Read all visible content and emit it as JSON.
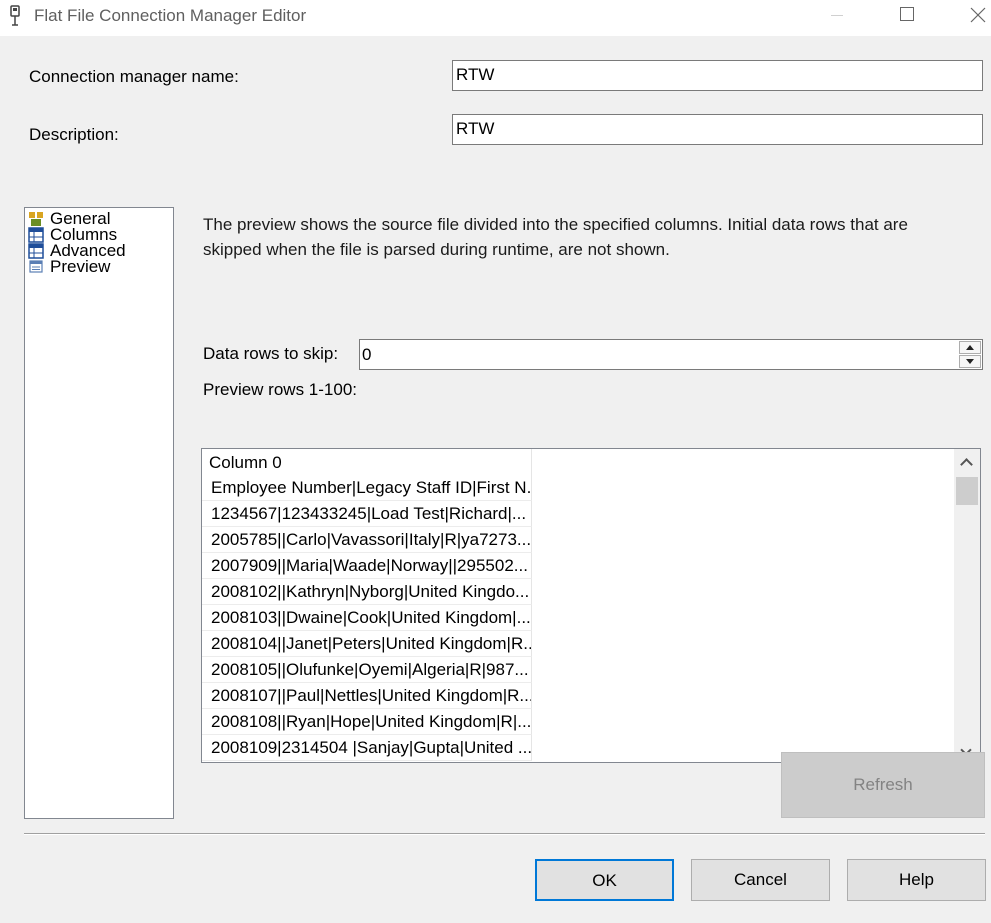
{
  "window": {
    "title": "Flat File Connection Manager Editor"
  },
  "form": {
    "name_label": "Connection manager name:",
    "name_value": "RTW",
    "description_label": "Description:",
    "description_value": "RTW"
  },
  "nav": {
    "items": [
      {
        "label": "General",
        "icon": "general-icon"
      },
      {
        "label": "Columns",
        "icon": "columns-icon"
      },
      {
        "label": "Advanced",
        "icon": "advanced-icon"
      },
      {
        "label": "Preview",
        "icon": "preview-icon"
      }
    ]
  },
  "preview": {
    "info": "The preview shows the source file divided into the specified columns. Initial data rows that are skipped when the file is parsed during runtime, are not shown.",
    "skip_label": "Data rows to skip:",
    "skip_value": "0",
    "rows_label": "Preview rows 1-100:",
    "column_header": "Column 0",
    "rows": [
      "Employee Number|Legacy Staff ID|First N...",
      "1234567|123433245|Load Test|Richard|...",
      "2005785||Carlo|Vavassori|Italy|R|ya7273...",
      "2007909||Maria|Waade|Norway||295502...",
      "2008102||Kathryn|Nyborg|United Kingdo...",
      "2008103||Dwaine|Cook|United Kingdom|...",
      "2008104||Janet|Peters|United Kingdom|R...",
      "2008105||Olufunke|Oyemi|Algeria|R|987...",
      "2008107||Paul|Nettles|United Kingdom|R...",
      "2008108||Ryan|Hope|United Kingdom|R|...",
      "2008109|2314504 |Sanjay|Gupta|United ..."
    ],
    "refresh_label": "Refresh"
  },
  "buttons": {
    "ok": "OK",
    "cancel": "Cancel",
    "help": "Help"
  },
  "colors": {
    "background": "#f0f0f0",
    "focus_border": "#0078d7",
    "disabled_button": "#cccccc"
  }
}
